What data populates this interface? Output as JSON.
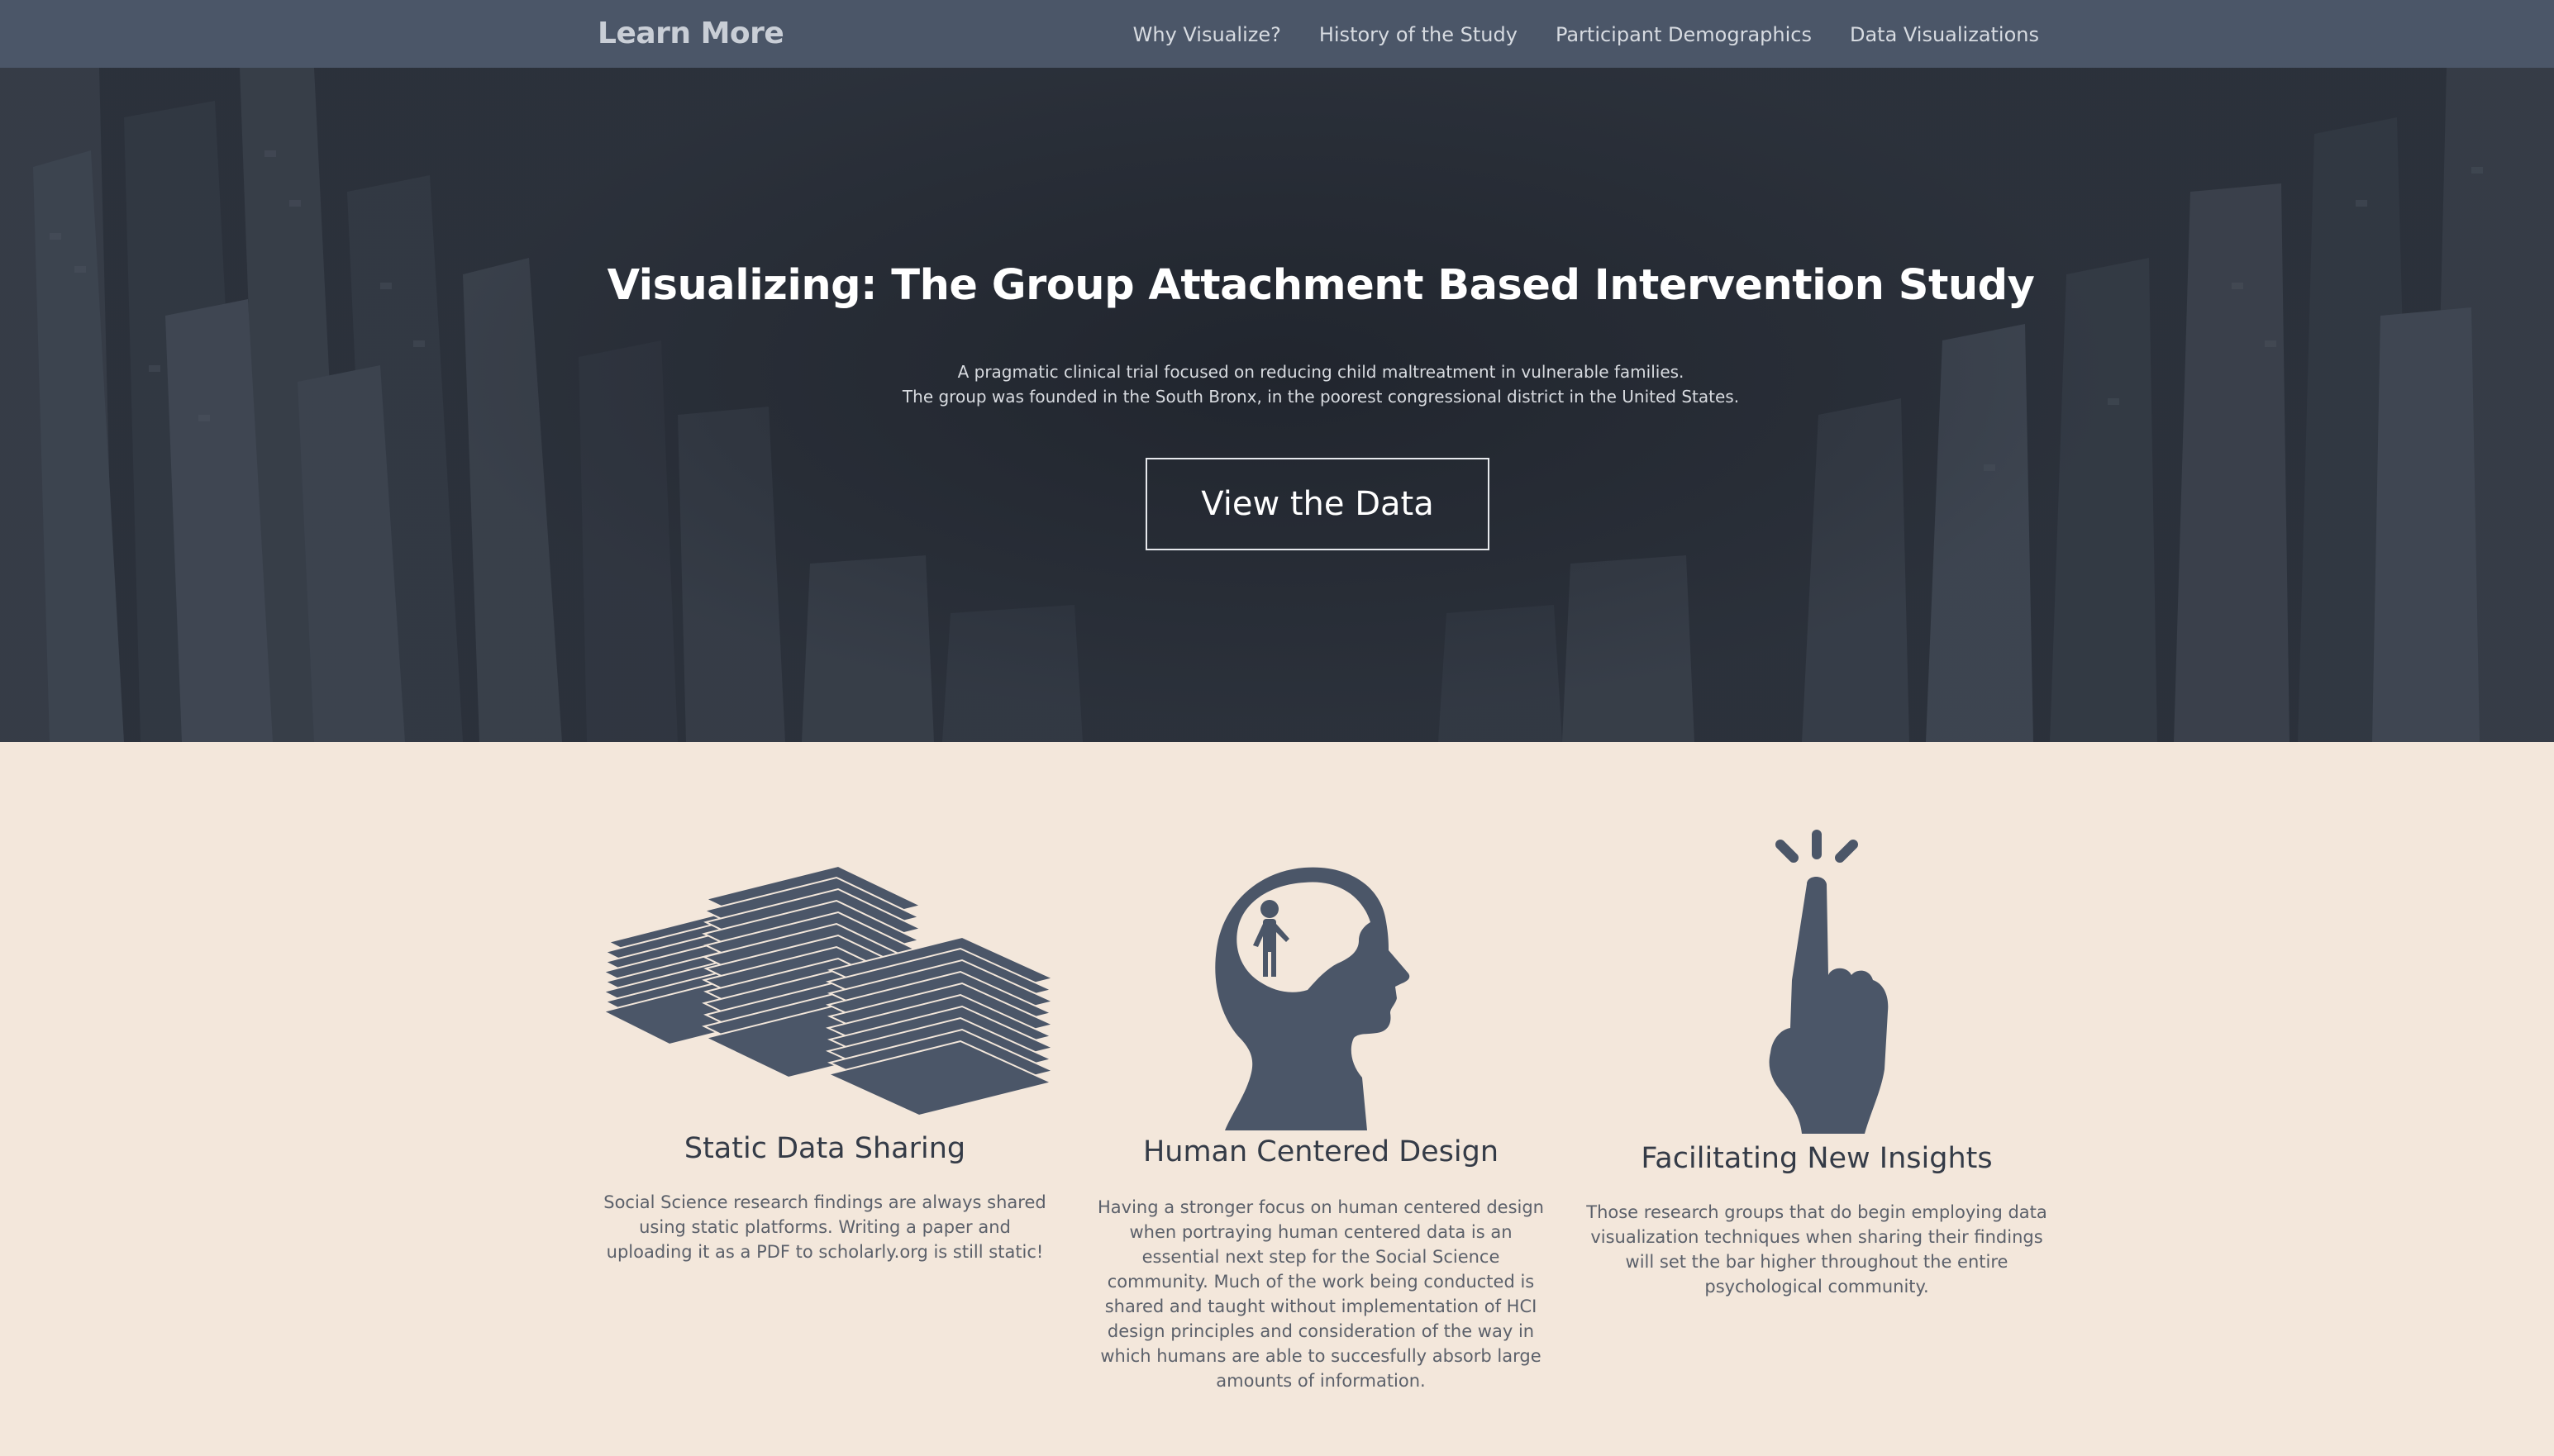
{
  "nav": {
    "brand": "Learn More",
    "links": [
      "Why Visualize?",
      "History of the Study",
      "Participant Demographics",
      "Data Visualizations"
    ]
  },
  "hero": {
    "title": "Visualizing: The Group Attachment Based Intervention Study",
    "subtitle_line1": "A pragmatic clinical trial focused on reducing child maltreatment in vulnerable families.",
    "subtitle_line2": "The group was founded in the South Bronx, in the poorest congressional district in the United States.",
    "button": "View the Data"
  },
  "features": [
    {
      "icon": "paper-stacks-icon",
      "title": "Static Data Sharing",
      "text": "Social Science research findings are always shared using static platforms. Writing a paper and uploading it as a PDF to scholarly.org is still static!"
    },
    {
      "icon": "head-with-person-icon",
      "title": "Human Centered Design",
      "text": "Having a stronger focus on human centered design when portraying human centered data is an essential next step for the Social Science community. Much of the work being conducted is shared and taught without implementation of HCI design principles and consideration of the way in which humans are able to succesfully absorb large amounts of information."
    },
    {
      "icon": "pointing-finger-icon",
      "title": "Facilitating New Insights",
      "text": "Those research groups that do begin employing data visualization techniques when sharing their findings will set the bar higher throughout the entire psychological community."
    }
  ],
  "colors": {
    "nav_bg": "#4b5668",
    "hero_bg": "#2c323c",
    "section_bg": "#f3e7db",
    "icon": "#4b5668"
  }
}
